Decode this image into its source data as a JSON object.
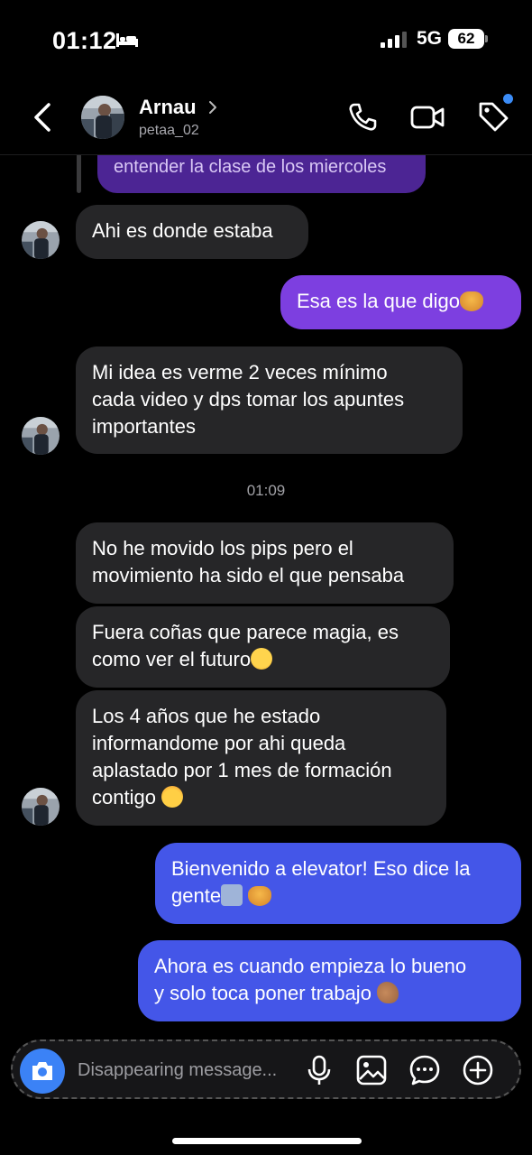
{
  "status_bar": {
    "time": "01:12",
    "network": "5G",
    "battery": "62"
  },
  "header": {
    "name": "Arnau",
    "username": "petaa_02"
  },
  "reply_preview": {
    "text": "entender la clase de los miercoles"
  },
  "messages": [
    {
      "side": "in",
      "text": "Ahi es donde estaba"
    },
    {
      "side": "out",
      "text": "Esa es la que digo"
    },
    {
      "side": "in",
      "lines": [
        "Mi idea es verme 2 veces mínimo",
        "cada video y dps tomar los apuntes",
        "importantes"
      ]
    },
    {
      "side": "in",
      "lines": [
        "No he movido los pips pero el",
        "movimiento ha sido el que pensaba"
      ]
    },
    {
      "side": "in",
      "lines": [
        "Fuera coñas que parece magia, es",
        "como ver el futuro"
      ]
    },
    {
      "side": "in",
      "lines": [
        "Los 4 años que he estado",
        "informandome por ahi queda",
        "aplastado por 1 mes de formación",
        "contigo "
      ]
    },
    {
      "side": "out",
      "lines": [
        "Bienvenido a elevator! Eso dice la",
        "gente"
      ]
    },
    {
      "side": "out",
      "lines": [
        "Ahora es cuando empieza lo bueno",
        "y solo toca poner trabajo "
      ]
    }
  ],
  "timestamp": "01:09",
  "composer": {
    "placeholder": "Disappearing message..."
  },
  "colors": {
    "incoming": "#262628",
    "outgoing_purple": "#7d3fe0",
    "outgoing_blue": "#4456e8",
    "accent": "#3b82f6"
  },
  "icons": [
    "bed-icon",
    "signal-icon",
    "back-icon",
    "chevron-right-icon",
    "phone-icon",
    "video-camera-icon",
    "tag-icon",
    "camera-icon",
    "microphone-icon",
    "image-icon",
    "sticker-icon",
    "plus-icon"
  ]
}
